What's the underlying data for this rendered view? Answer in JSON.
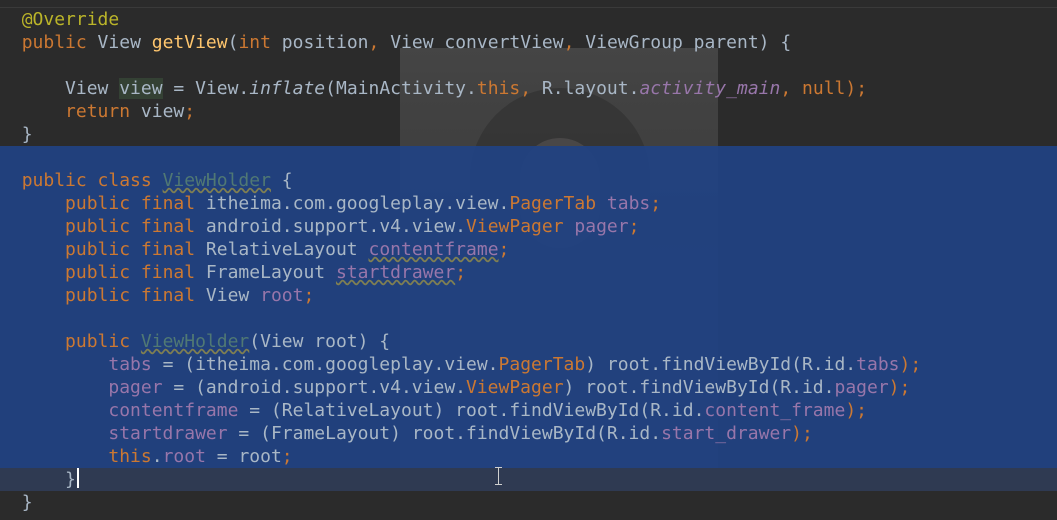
{
  "editor": {
    "lines": [
      {
        "indent": "  ",
        "tokens": [
          {
            "t": "@Override",
            "c": "ann"
          }
        ]
      },
      {
        "indent": "  ",
        "tokens": [
          {
            "t": "public",
            "c": "kw"
          },
          {
            "t": " View ",
            "c": "pl"
          },
          {
            "t": "getView",
            "c": "fn"
          },
          {
            "t": "(",
            "c": "pl"
          },
          {
            "t": "int",
            "c": "kw"
          },
          {
            "t": " position",
            "c": "pl"
          },
          {
            "t": ",",
            "c": "kw"
          },
          {
            "t": " View convertView",
            "c": "pl"
          },
          {
            "t": ",",
            "c": "kw"
          },
          {
            "t": " ViewGroup parent) {",
            "c": "pl"
          }
        ]
      },
      {
        "indent": "",
        "tokens": []
      },
      {
        "indent": "      ",
        "tokens": [
          {
            "t": "View ",
            "c": "pl"
          },
          {
            "t": "view",
            "c": "pl var-hl"
          },
          {
            "t": " = View.",
            "c": "pl"
          },
          {
            "t": "inflate",
            "c": "pl it"
          },
          {
            "t": "(MainActivity.",
            "c": "pl"
          },
          {
            "t": "this",
            "c": "kw"
          },
          {
            "t": ", ",
            "c": "kw"
          },
          {
            "t": "R.layout.",
            "c": "pl"
          },
          {
            "t": "activity_main",
            "c": "fld it"
          },
          {
            "t": ", ",
            "c": "kw"
          },
          {
            "t": "null",
            "c": "kw"
          },
          {
            "t": ");",
            "c": "kw"
          }
        ]
      },
      {
        "indent": "      ",
        "tokens": [
          {
            "t": "return",
            "c": "kw"
          },
          {
            "t": " view",
            "c": "pl"
          },
          {
            "t": ";",
            "c": "kw"
          }
        ]
      },
      {
        "indent": "  ",
        "tokens": [
          {
            "t": "}",
            "c": "pl"
          }
        ]
      },
      {
        "indent": "",
        "tokens": []
      },
      {
        "indent": "  ",
        "tokens": [
          {
            "t": "public class ",
            "c": "kw"
          },
          {
            "t": "ViewHolder",
            "c": "cls squig"
          },
          {
            "t": " {",
            "c": "pl"
          }
        ]
      },
      {
        "indent": "      ",
        "tokens": [
          {
            "t": "public final ",
            "c": "kw"
          },
          {
            "t": "itheima.com.googleplay.view.",
            "c": "pl"
          },
          {
            "t": "PagerTab",
            "c": "kw"
          },
          {
            "t": " tabs",
            "c": "fld"
          },
          {
            "t": ";",
            "c": "kw"
          }
        ]
      },
      {
        "indent": "      ",
        "tokens": [
          {
            "t": "public final ",
            "c": "kw"
          },
          {
            "t": "android.support.v4.view.",
            "c": "pl"
          },
          {
            "t": "ViewPager",
            "c": "kw"
          },
          {
            "t": " pager",
            "c": "fld"
          },
          {
            "t": ";",
            "c": "kw"
          }
        ]
      },
      {
        "indent": "      ",
        "tokens": [
          {
            "t": "public final ",
            "c": "kw"
          },
          {
            "t": "RelativeLayout ",
            "c": "pl"
          },
          {
            "t": "contentframe",
            "c": "fld squig"
          },
          {
            "t": ";",
            "c": "kw"
          }
        ]
      },
      {
        "indent": "      ",
        "tokens": [
          {
            "t": "public final ",
            "c": "kw"
          },
          {
            "t": "FrameLayout ",
            "c": "pl"
          },
          {
            "t": "startdrawer",
            "c": "fld squig"
          },
          {
            "t": ";",
            "c": "kw"
          }
        ]
      },
      {
        "indent": "      ",
        "tokens": [
          {
            "t": "public final ",
            "c": "kw"
          },
          {
            "t": "View ",
            "c": "pl"
          },
          {
            "t": "root",
            "c": "fld"
          },
          {
            "t": ";",
            "c": "kw"
          }
        ]
      },
      {
        "indent": "",
        "tokens": []
      },
      {
        "indent": "      ",
        "tokens": [
          {
            "t": "public ",
            "c": "kw"
          },
          {
            "t": "ViewHolder",
            "c": "cls squig"
          },
          {
            "t": "(View root) {",
            "c": "pl"
          }
        ]
      },
      {
        "indent": "          ",
        "tokens": [
          {
            "t": "tabs",
            "c": "fld"
          },
          {
            "t": " = (itheima.com.googleplay.view.",
            "c": "pl"
          },
          {
            "t": "PagerTab",
            "c": "kw"
          },
          {
            "t": ") root.findViewById(R.id.",
            "c": "pl"
          },
          {
            "t": "tabs",
            "c": "fld"
          },
          {
            "t": ");",
            "c": "kw"
          }
        ]
      },
      {
        "indent": "          ",
        "tokens": [
          {
            "t": "pager",
            "c": "fld"
          },
          {
            "t": " = (android.support.v4.view.",
            "c": "pl"
          },
          {
            "t": "ViewPager",
            "c": "kw"
          },
          {
            "t": ") root.findViewById(R.id.",
            "c": "pl"
          },
          {
            "t": "pager",
            "c": "fld"
          },
          {
            "t": ");",
            "c": "kw"
          }
        ]
      },
      {
        "indent": "          ",
        "tokens": [
          {
            "t": "contentframe",
            "c": "fld"
          },
          {
            "t": " = (RelativeLayout) root.findViewById(R.id.",
            "c": "pl"
          },
          {
            "t": "content_frame",
            "c": "fld"
          },
          {
            "t": ");",
            "c": "kw"
          }
        ]
      },
      {
        "indent": "          ",
        "tokens": [
          {
            "t": "startdrawer",
            "c": "fld"
          },
          {
            "t": " = (FrameLayout) root.findViewById(R.id.",
            "c": "pl"
          },
          {
            "t": "start_drawer",
            "c": "fld"
          },
          {
            "t": ");",
            "c": "kw"
          }
        ]
      },
      {
        "indent": "          ",
        "tokens": [
          {
            "t": "this",
            "c": "kw"
          },
          {
            "t": ".",
            "c": "pl"
          },
          {
            "t": "root",
            "c": "fld"
          },
          {
            "t": " = root",
            "c": "pl"
          },
          {
            "t": ";",
            "c": "kw"
          }
        ]
      },
      {
        "indent": "      ",
        "tokens": [
          {
            "t": "}",
            "c": "pl"
          }
        ],
        "caret": true
      },
      {
        "indent": "  ",
        "tokens": [
          {
            "t": "}",
            "c": "pl"
          }
        ]
      }
    ]
  },
  "colors": {
    "background": "#2b2b2b",
    "selection": "#214283",
    "keyword": "#cc7832",
    "annotation": "#bbb529",
    "method": "#ffc66d",
    "field": "#9876aa",
    "plain": "#a9b7c6"
  },
  "icons": {
    "cursor": "ibeam-cursor-icon"
  }
}
